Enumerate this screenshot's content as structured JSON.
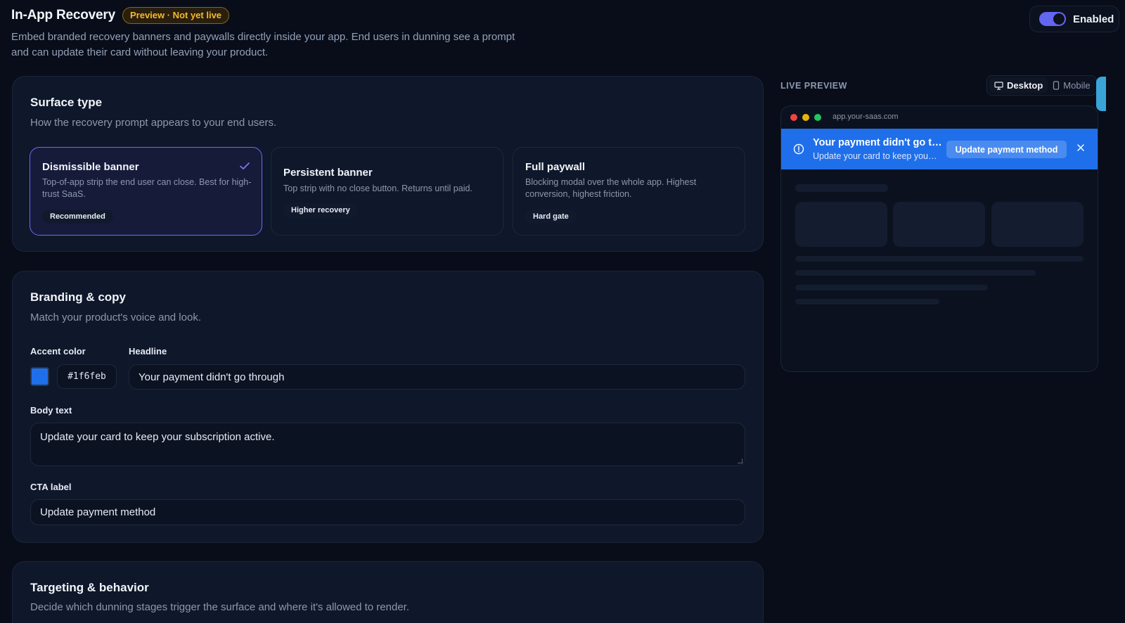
{
  "header": {
    "title": "In-App Recovery",
    "badge": "Preview · Not yet live",
    "description": "Embed branded recovery banners and paywalls directly inside your app. End users in dunning see a prompt and can update their card without leaving your product.",
    "toggle_label": "Enabled",
    "toggle_on": true
  },
  "surface": {
    "title": "Surface type",
    "subtitle": "How the recovery prompt appears to your end users.",
    "options": [
      {
        "title": "Dismissible banner",
        "desc": "Top-of-app strip the end user can close. Best for high-trust SaaS.",
        "tag": "Recommended",
        "selected": true
      },
      {
        "title": "Persistent banner",
        "desc": "Top strip with no close button. Returns until paid.",
        "tag": "Higher recovery",
        "selected": false
      },
      {
        "title": "Full paywall",
        "desc": "Blocking modal over the whole app. Highest conversion, highest friction.",
        "tag": "Hard gate",
        "selected": false
      }
    ]
  },
  "branding": {
    "title": "Branding & copy",
    "subtitle": "Match your product's voice and look.",
    "accent_label": "Accent color",
    "accent_value": "#1f6feb",
    "headline_label": "Headline",
    "headline_value": "Your payment didn't go through",
    "body_label": "Body text",
    "body_value": "Update your card to keep your subscription active.",
    "cta_label": "CTA label",
    "cta_value": "Update payment method"
  },
  "targeting": {
    "title": "Targeting & behavior",
    "subtitle": "Decide which dunning stages trigger the surface and where it's allowed to render."
  },
  "preview": {
    "label": "LIVE PREVIEW",
    "devices": [
      "Desktop",
      "Mobile"
    ],
    "active_device": "Desktop",
    "url": "app.your-saas.com",
    "banner_headline": "Your payment didn't go through",
    "banner_body": "Update your card to keep your subscription active.",
    "banner_cta": "Update payment method"
  },
  "colors": {
    "accent": "#1f6feb",
    "brand": "#6366f1",
    "badge": "#f5b930"
  }
}
